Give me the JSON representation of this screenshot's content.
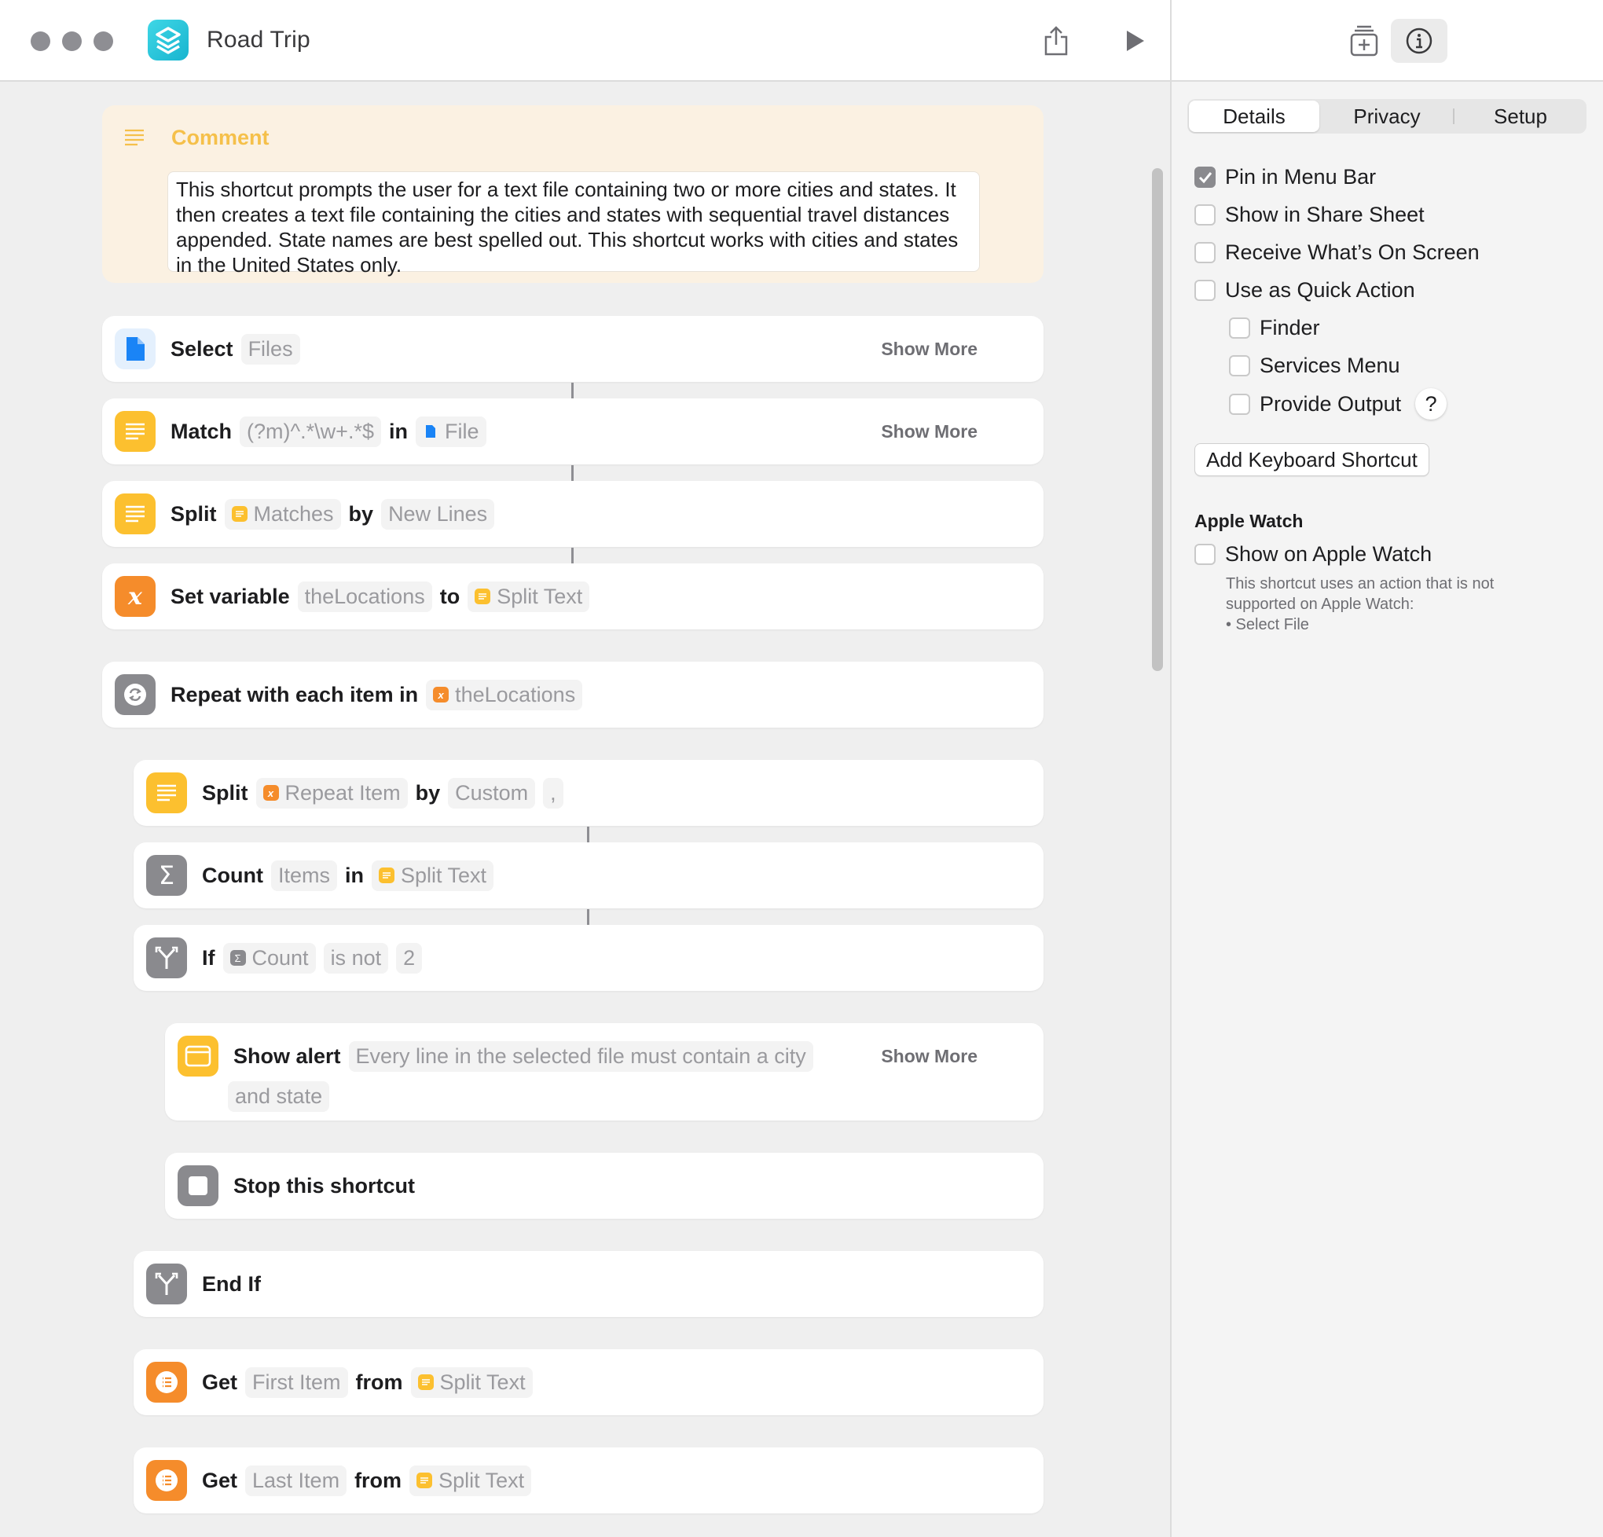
{
  "window": {
    "title": "Road Trip"
  },
  "toolbar": {
    "share_icon": "share-icon",
    "run_icon": "play-icon",
    "library_icon": "action-library-icon",
    "info_icon": "info-icon"
  },
  "comment": {
    "title": "Comment",
    "text": "This shortcut prompts the user for a text file containing two or more cities and states. It then creates a text file containing the cities and states with sequential travel distances appended. State names are best spelled out. This shortcut works with cities and states in the United States only."
  },
  "actions": {
    "select": {
      "verb": "Select",
      "param": "Files",
      "more": "Show More"
    },
    "match": {
      "verb": "Match",
      "pattern": "(?m)^.*\\w+.*$",
      "in": "in",
      "source": "File",
      "more": "Show More"
    },
    "split1": {
      "verb": "Split",
      "source": "Matches",
      "by": "by",
      "sep": "New Lines"
    },
    "setvar": {
      "verb": "Set variable",
      "name": "theLocations",
      "to": "to",
      "value": "Split Text"
    },
    "repeat": {
      "verb": "Repeat with each item in",
      "source": "theLocations"
    },
    "split2": {
      "verb": "Split",
      "source": "Repeat Item",
      "by": "by",
      "sep": "Custom",
      "custom": ","
    },
    "count": {
      "verb": "Count",
      "what": "Items",
      "in": "in",
      "source": "Split Text"
    },
    "if": {
      "verb": "If",
      "source": "Count",
      "cond": "is not",
      "value": "2"
    },
    "alert": {
      "verb": "Show alert",
      "msg1": "Every line in the selected file must contain a city",
      "msg2": "and state",
      "more": "Show More"
    },
    "stop": {
      "verb": "Stop this shortcut"
    },
    "endif": {
      "verb": "End If"
    },
    "get1": {
      "verb": "Get",
      "what": "First Item",
      "from": "from",
      "source": "Split Text"
    },
    "get2": {
      "verb": "Get",
      "what": "Last Item",
      "from": "from",
      "source": "Split Text"
    }
  },
  "sidebar": {
    "tabs": [
      "Details",
      "Privacy",
      "Setup"
    ],
    "selected_tab": "Details",
    "options": [
      {
        "label": "Pin in Menu Bar",
        "checked": true
      },
      {
        "label": "Show in Share Sheet",
        "checked": false
      },
      {
        "label": "Receive What’s On Screen",
        "checked": false
      },
      {
        "label": "Use as Quick Action",
        "checked": false
      },
      {
        "label": "Finder",
        "checked": false
      },
      {
        "label": "Services Menu",
        "checked": false
      },
      {
        "label": "Provide Output",
        "checked": false
      }
    ],
    "help": "?",
    "keyboard_button": "Add Keyboard Shortcut",
    "apple_watch": {
      "heading": "Apple Watch",
      "option": "Show on Apple Watch",
      "checked": false,
      "note1": "This shortcut uses an action that is not",
      "note2": "supported on Apple Watch:",
      "note3": "• Select File"
    }
  },
  "colors": {
    "yellow": "#fcc02f",
    "orange": "#f58c2b",
    "blue": "#1a84f6",
    "gray": "#8a8a8e",
    "teal": "#1ec3d9",
    "comment_title": "#f5c04a"
  }
}
